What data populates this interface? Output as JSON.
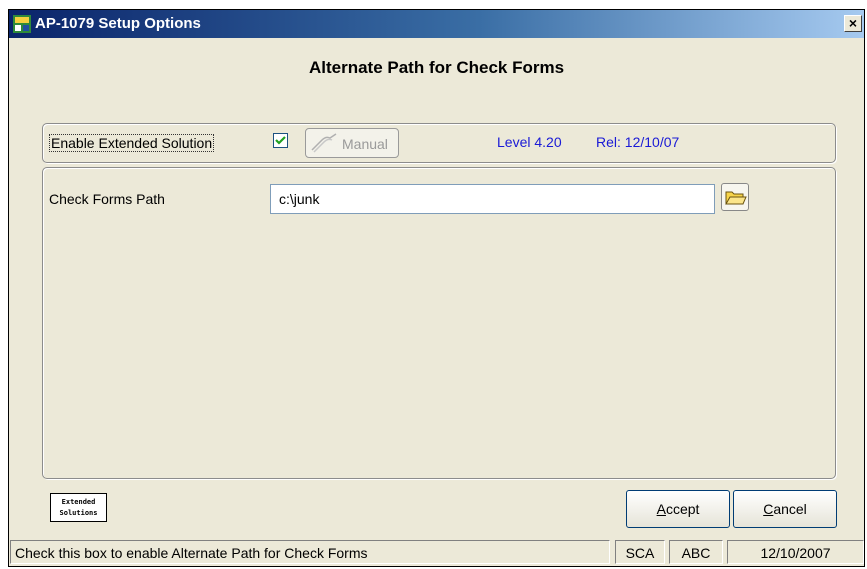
{
  "window": {
    "title": "AP-1079 Setup Options",
    "close_label": "×"
  },
  "heading": "Alternate Path for Check Forms",
  "options": {
    "enable_label": "Enable Extended Solution",
    "enable_checked": true,
    "manual_label": "Manual",
    "level": "Level 4.20",
    "release": "Rel: 12/10/07"
  },
  "form": {
    "path_label": "Check Forms Path",
    "path_value": "c:\\junk"
  },
  "logo": {
    "line1": "Extended",
    "line2": "Solutions"
  },
  "buttons": {
    "accept_first": "A",
    "accept_rest": "ccept",
    "cancel_first": "C",
    "cancel_rest": "ancel"
  },
  "statusbar": {
    "message": "Check this box to enable Alternate Path for Check Forms",
    "company": "SCA",
    "user": "ABC",
    "date": "12/10/2007"
  }
}
